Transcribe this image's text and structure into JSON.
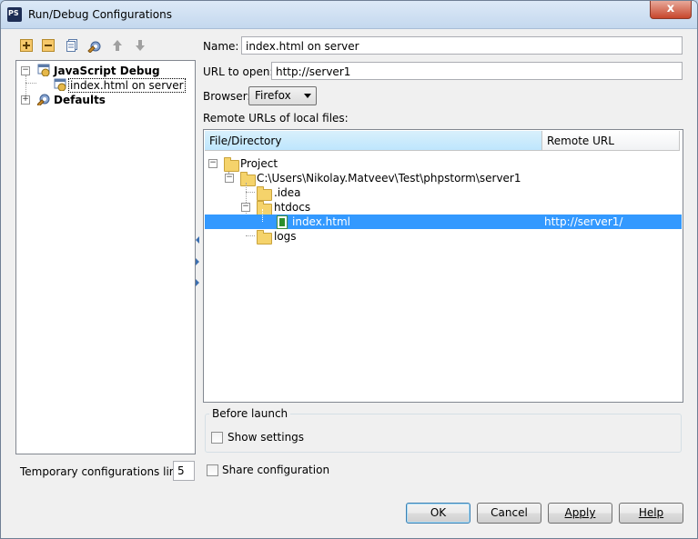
{
  "window": {
    "title": "Run/Debug Configurations",
    "close_glyph": "x"
  },
  "toolbar": {
    "buttons": [
      "add-icon",
      "remove-icon",
      "copy-icon",
      "edit-defaults-icon",
      "move-up-icon",
      "move-down-icon"
    ]
  },
  "tree": {
    "items": [
      {
        "label": "JavaScript Debug",
        "expander": "−",
        "bold": true
      },
      {
        "label": "index.html on server",
        "selected": true
      },
      {
        "label": "Defaults",
        "expander": "+",
        "bold": true
      }
    ]
  },
  "form": {
    "name_label": "Name:",
    "name_value": "index.html on server",
    "url_label": "URL to open:",
    "url_value": "http://server1",
    "browser_label": "Browser:",
    "browser_value": "Firefox",
    "remote_urls_label": "Remote URLs of local files:"
  },
  "table": {
    "columns": [
      "File/Directory",
      "Remote URL"
    ],
    "rows": [
      {
        "label": "Project",
        "remote": "",
        "expander": "−"
      },
      {
        "label": "C:\\Users\\Nikolay.Matveev\\Test\\phpstorm\\server1",
        "remote": "",
        "expander": "−"
      },
      {
        "label": ".idea",
        "remote": ""
      },
      {
        "label": "htdocs",
        "remote": "",
        "expander": "−"
      },
      {
        "label": "index.html",
        "remote": "http://server1/",
        "selected": true
      },
      {
        "label": "logs",
        "remote": ""
      }
    ]
  },
  "before_launch": {
    "title": "Before launch",
    "show_settings_label": "Show settings"
  },
  "share_label": "Share configuration",
  "temp_limit": {
    "label": "Temporary configurations limit:",
    "value": "5"
  },
  "buttons": {
    "ok": "OK",
    "cancel": "Cancel",
    "apply": "Apply",
    "help": "Help"
  },
  "colors": {
    "selection": "#3399ff",
    "header_selected": "#bee6fd"
  }
}
